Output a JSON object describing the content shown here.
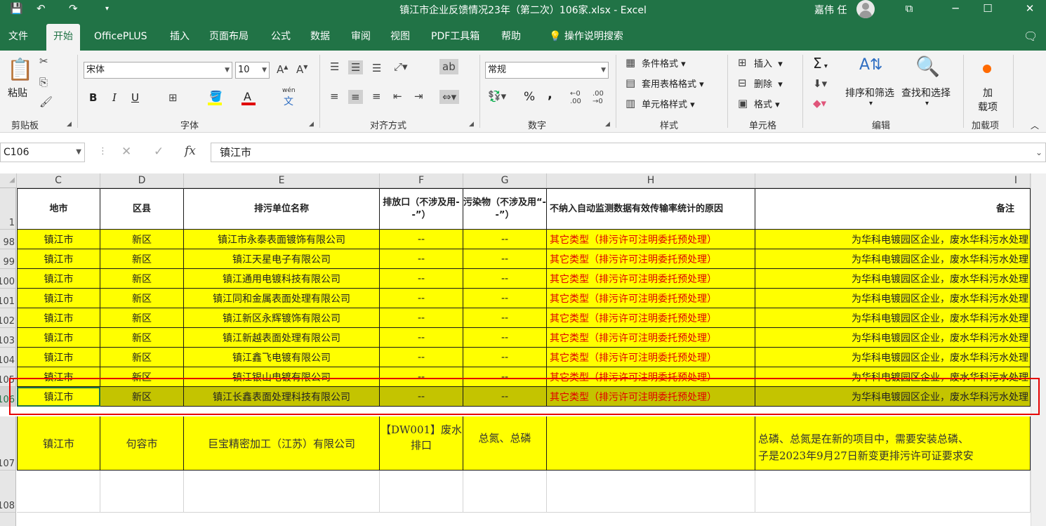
{
  "window": {
    "title": "镇江市企业反馈情况23年（第二次）106家.xlsx  -  Excel",
    "user": "嘉伟 任",
    "controls": {
      "minimize": "─",
      "maximize": "☐",
      "close": "✕",
      "ribbon_display": "⧉"
    }
  },
  "tabs": [
    "文件",
    "开始",
    "OfficePLUS",
    "插入",
    "页面布局",
    "公式",
    "数据",
    "审阅",
    "视图",
    "PDF工具箱",
    "帮助"
  ],
  "active_tab": "开始",
  "tell_me": "操作说明搜索",
  "ribbon": {
    "clipboard": {
      "paste": "粘贴",
      "label": "剪贴板"
    },
    "font": {
      "name": "宋体",
      "size": "10",
      "label": "字体",
      "bold": "B",
      "italic": "I",
      "underline": "U",
      "wen": "wén",
      "wen2": "文"
    },
    "alignment": {
      "label": "对齐方式"
    },
    "number": {
      "format": "常规",
      "label": "数字",
      "percent": "%",
      "comma": ","
    },
    "styles": {
      "conditional": "条件格式",
      "table": "套用表格格式",
      "cell": "单元格样式",
      "label": "样式"
    },
    "cells": {
      "insert": "插入",
      "delete": "删除",
      "format": "格式",
      "label": "单元格"
    },
    "editing": {
      "sort": "排序和筛选",
      "find": "查找和选择",
      "label": "编辑",
      "sigma": "Σ"
    },
    "addins": {
      "add1": "加",
      "add2": "载项",
      "label": "加载项"
    }
  },
  "formula_bar": {
    "name_box": "C106",
    "content": "镇江市",
    "fx": "fx",
    "cancel": "✕",
    "enter": "✓"
  },
  "columns": [
    "C",
    "D",
    "E",
    "F",
    "G",
    "H",
    "I"
  ],
  "header_row": {
    "row_num": "1",
    "cells": [
      "地市",
      "区县",
      "排污单位名称",
      "排放口（不涉及用--”）",
      "污染物（不涉及用“--”）",
      "不纳入自动监测数据有效传输率统计的原因",
      "备注"
    ]
  },
  "rows": [
    {
      "num": "98",
      "city": "镇江市",
      "district": "新区",
      "company": "镇江市永泰表面镀饰有限公司",
      "outlet": "--",
      "pollutant": "--",
      "reason": "其它类型（排污许可注明委托预处理）",
      "note": "为华科电镀园区企业，废水华科污水处理"
    },
    {
      "num": "99",
      "city": "镇江市",
      "district": "新区",
      "company": "镇江天星电子有限公司",
      "outlet": "--",
      "pollutant": "--",
      "reason": "其它类型（排污许可注明委托预处理）",
      "note": "为华科电镀园区企业，废水华科污水处理"
    },
    {
      "num": "100",
      "city": "镇江市",
      "district": "新区",
      "company": "镇江通用电镀科技有限公司",
      "outlet": "--",
      "pollutant": "--",
      "reason": "其它类型（排污许可注明委托预处理）",
      "note": "为华科电镀园区企业，废水华科污水处理"
    },
    {
      "num": "101",
      "city": "镇江市",
      "district": "新区",
      "company": "镇江同和金属表面处理有限公司",
      "outlet": "--",
      "pollutant": "--",
      "reason": "其它类型（排污许可注明委托预处理）",
      "note": "为华科电镀园区企业，废水华科污水处理"
    },
    {
      "num": "102",
      "city": "镇江市",
      "district": "新区",
      "company": "镇江新区永辉镀饰有限公司",
      "outlet": "--",
      "pollutant": "--",
      "reason": "其它类型（排污许可注明委托预处理）",
      "note": "为华科电镀园区企业，废水华科污水处理"
    },
    {
      "num": "103",
      "city": "镇江市",
      "district": "新区",
      "company": "镇江新越表面处理有限公司",
      "outlet": "--",
      "pollutant": "--",
      "reason": "其它类型（排污许可注明委托预处理）",
      "note": "为华科电镀园区企业，废水华科污水处理"
    },
    {
      "num": "104",
      "city": "镇江市",
      "district": "新区",
      "company": "镇江鑫飞电镀有限公司",
      "outlet": "--",
      "pollutant": "--",
      "reason": "其它类型（排污许可注明委托预处理）",
      "note": "为华科电镀园区企业，废水华科污水处理"
    },
    {
      "num": "105",
      "city": "镇江市",
      "district": "新区",
      "company": "镇江银山电镀有限公司",
      "outlet": "--",
      "pollutant": "--",
      "reason": "其它类型（排污许可注明委托预处理）",
      "note": "为华科电镀园区企业，废水华科污水处理"
    },
    {
      "num": "106",
      "city": "镇江市",
      "district": "新区",
      "company": "镇江长鑫表面处理科技有限公司",
      "outlet": "--",
      "pollutant": "--",
      "reason": "其它类型（排污许可注明委托预处理）",
      "note": "为华科电镀园区企业，废水华科污水处理"
    }
  ],
  "row107": {
    "num": "107",
    "city": "镇江市",
    "district": "句容市",
    "company": "巨宝精密加工（江苏）有限公司",
    "outlet": "【DW001】废水排口",
    "pollutant": "总氮、总磷",
    "reason": "",
    "note_line1": "总磷、总氮是在新的项目中，需要安装总磷、",
    "note_line2": "子是2023年9月27日新变更排污许可证要求安"
  },
  "row108": {
    "num": "108"
  }
}
